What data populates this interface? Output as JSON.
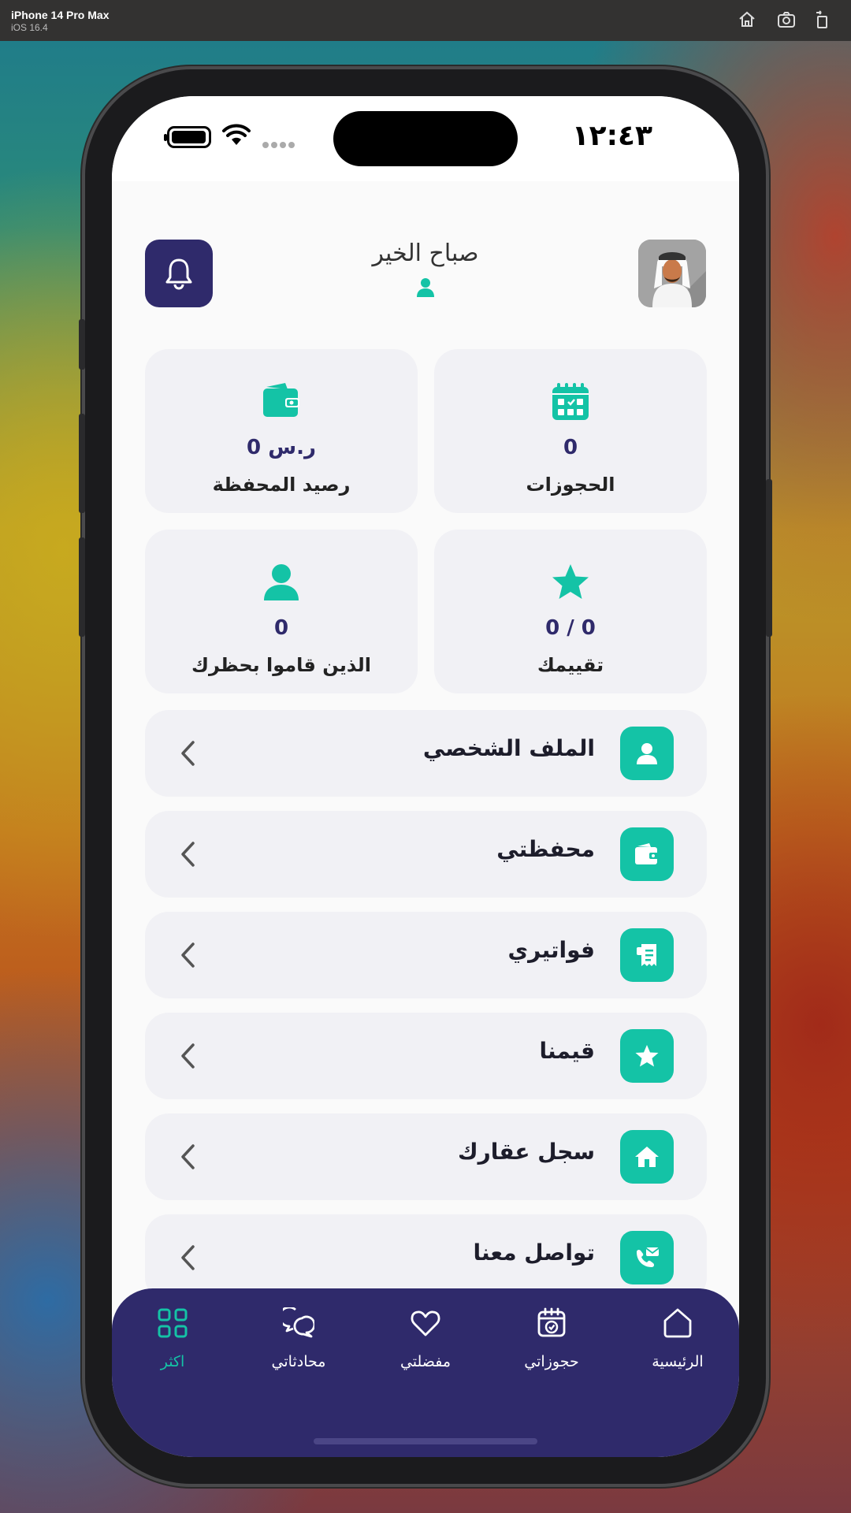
{
  "simulator": {
    "device": "iPhone 14 Pro Max",
    "os": "iOS 16.4",
    "buttons": [
      "home-icon",
      "screenshot-icon",
      "rotate-icon"
    ]
  },
  "status_bar": {
    "time": "١٢:٤٣"
  },
  "header": {
    "greeting": "صباح الخير",
    "bell_icon": "bell-icon",
    "avatar": "user-avatar"
  },
  "stats": [
    {
      "label": "رصيد المحفظة",
      "value": "0 ر.س",
      "icon": "wallet-icon"
    },
    {
      "label": "الحجوزات",
      "value": "0",
      "icon": "calendar-icon"
    },
    {
      "label": "الذين قاموا بحظرك",
      "value": "0",
      "icon": "user-icon"
    },
    {
      "label": "تقييمك",
      "value": "0 / 0",
      "icon": "star-icon"
    }
  ],
  "menu": [
    {
      "label": "الملف الشخصي",
      "icon": "user-icon"
    },
    {
      "label": "محفظتي",
      "icon": "wallet-icon"
    },
    {
      "label": "فواتيري",
      "icon": "receipt-icon"
    },
    {
      "label": "قيمنا",
      "icon": "star-icon"
    },
    {
      "label": "سجل عقارك",
      "icon": "house-icon"
    },
    {
      "label": "تواصل معنا",
      "icon": "contact-icon"
    }
  ],
  "tabs": [
    {
      "label": "اكثر",
      "icon": "grid-icon",
      "active": true
    },
    {
      "label": "محادثاتي",
      "icon": "chat-icon",
      "active": false
    },
    {
      "label": "مفضلتي",
      "icon": "heart-icon",
      "active": false
    },
    {
      "label": "حجوزاتي",
      "icon": "calendar-check-icon",
      "active": false
    },
    {
      "label": "الرئيسية",
      "icon": "home-icon",
      "active": false
    }
  ],
  "colors": {
    "primary": "#2f2a6b",
    "accent": "#14c3a6",
    "card_bg": "#f1f1f5",
    "screen_bg": "#fafafa"
  }
}
